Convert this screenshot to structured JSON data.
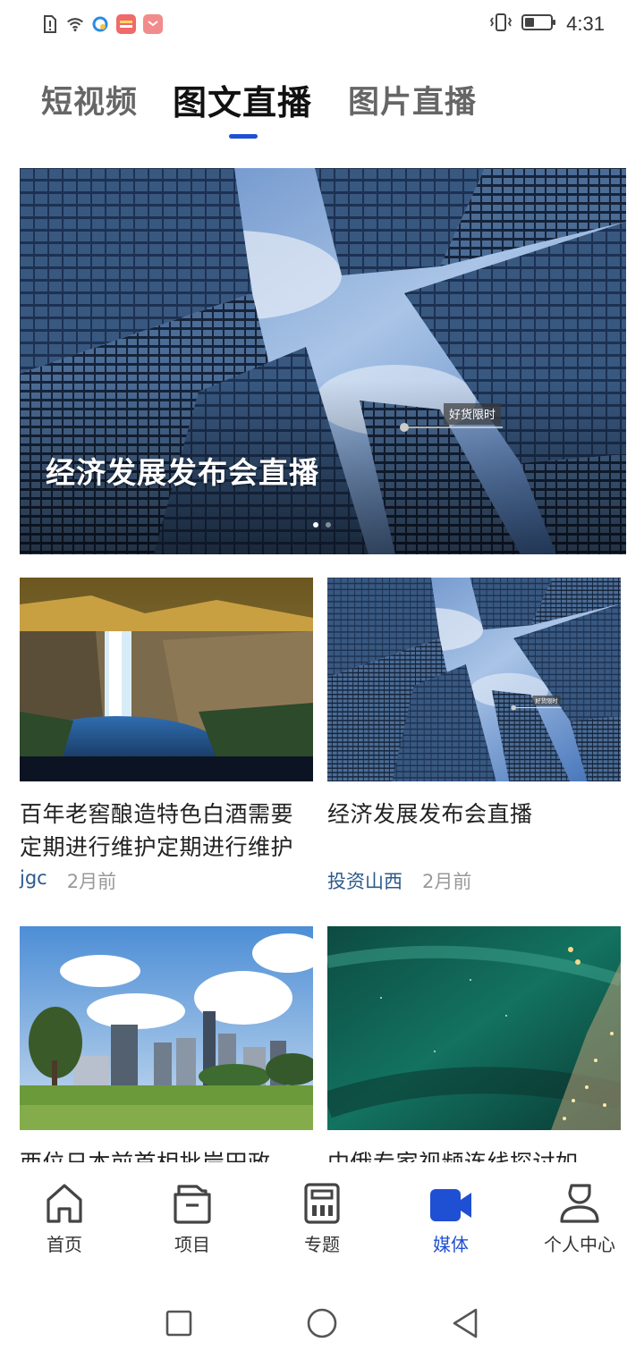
{
  "status_bar": {
    "time": "4:31",
    "icons": [
      "sim-alert-icon",
      "wifi-icon",
      "app-notification-icon",
      "app-notification-icon",
      "app-notification-icon",
      "vibrate-icon",
      "battery-icon"
    ]
  },
  "tabs": [
    {
      "label": "短视频",
      "active": false
    },
    {
      "label": "图文直播",
      "active": true
    },
    {
      "label": "图片直播",
      "active": false
    }
  ],
  "banner": {
    "title": "经济发展发布会直播",
    "overlay_tag": "好货限时",
    "page_count": 2,
    "current_page": 1
  },
  "cards": [
    {
      "title": "百年老窖酿造特色白酒需要 定期进行维护定期进行维护",
      "source": "jgc",
      "time": "2月前",
      "image": "waterfall"
    },
    {
      "title": "经济发展发布会直播",
      "source": "投资山西",
      "time": "2月前",
      "image": "skyscrapers",
      "overlay_tag": "好货限时"
    },
    {
      "title": "西位日本前首相批岸田政",
      "image": "city-park"
    },
    {
      "title": "中俄专家视频连线探讨如",
      "image": "green-festive"
    }
  ],
  "bottom_nav": [
    {
      "label": "首页",
      "icon": "home-icon",
      "active": false
    },
    {
      "label": "项目",
      "icon": "folder-icon",
      "active": false
    },
    {
      "label": "专题",
      "icon": "calculator-icon",
      "active": false
    },
    {
      "label": "媒体",
      "icon": "video-camera-icon",
      "active": true
    },
    {
      "label": "个人中心",
      "icon": "person-icon",
      "active": false
    }
  ],
  "colors": {
    "accent": "#1f4fd3",
    "source_text": "#2c5a8c",
    "muted_text": "#999999"
  }
}
